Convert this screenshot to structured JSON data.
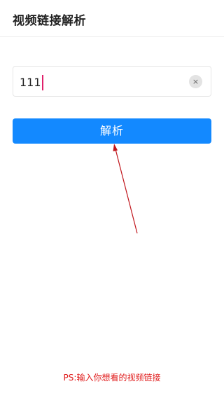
{
  "header": {
    "title": "视频链接解析"
  },
  "input": {
    "value": "111",
    "clear_icon": "×"
  },
  "parse_button": {
    "label": "解析"
  },
  "annotation": {
    "hint": "PS:输入你想看的视频链接",
    "color": "#e01b1b"
  },
  "colors": {
    "accent": "#1389ff",
    "caret": "#e0216b"
  }
}
